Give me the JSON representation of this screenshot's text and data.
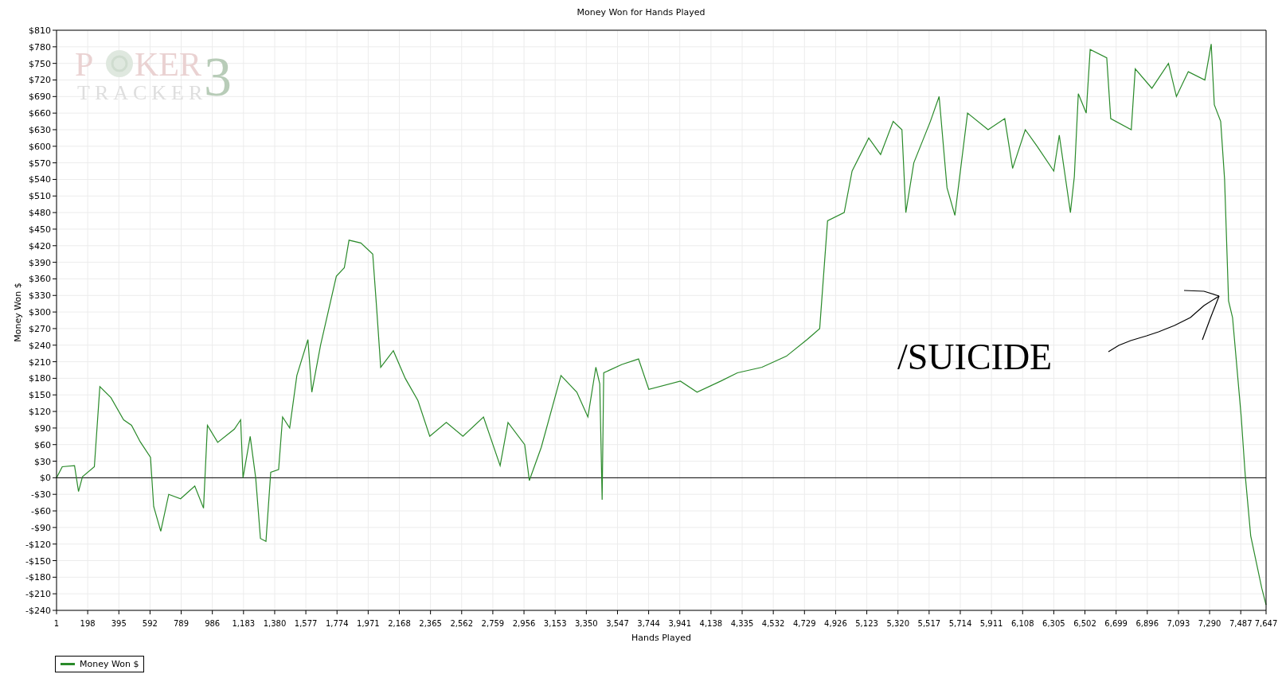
{
  "chart": {
    "watermark": {
      "first": "P",
      "rest": "KER",
      "numeral": "3",
      "second_line": "TRACKER"
    },
    "chart_data": {
      "type": "line",
      "title": "Money Won for Hands Played",
      "xlabel": "Hands Played",
      "ylabel": "Money Won $",
      "x": [
        1,
        37,
        115,
        140,
        165,
        240,
        275,
        345,
        425,
        475,
        530,
        595,
        615,
        660,
        710,
        785,
        875,
        930,
        955,
        1020,
        1125,
        1165,
        1180,
        1225,
        1260,
        1290,
        1325,
        1355,
        1405,
        1430,
        1475,
        1520,
        1590,
        1615,
        1670,
        1770,
        1820,
        1850,
        1925,
        2000,
        2025,
        2050,
        2130,
        2205,
        2285,
        2360,
        2465,
        2570,
        2700,
        2805,
        2855,
        2960,
        2990,
        3065,
        3190,
        3290,
        3360,
        3410,
        3435,
        3450,
        3460,
        3575,
        3680,
        3745,
        3945,
        4050,
        4200,
        4305,
        4460,
        4615,
        4745,
        4825,
        4875,
        4980,
        5030,
        5135,
        5210,
        5290,
        5345,
        5370,
        5420,
        5525,
        5580,
        5630,
        5680,
        5760,
        5890,
        5995,
        6045,
        6125,
        6200,
        6305,
        6340,
        6410,
        6435,
        6460,
        6510,
        6535,
        6640,
        6665,
        6795,
        6820,
        6925,
        7030,
        7080,
        7155,
        7260,
        7300,
        7320,
        7360,
        7385,
        7410,
        7435,
        7490,
        7515,
        7550,
        7620,
        7647
      ],
      "series": [
        {
          "name": "Money Won $",
          "color": "#2a8a2a",
          "values": [
            0,
            20,
            22,
            -25,
            2,
            20,
            165,
            145,
            105,
            95,
            65,
            37,
            -52,
            -97,
            -30,
            -38,
            -15,
            -55,
            95,
            64,
            88,
            105,
            0,
            75,
            0,
            -110,
            -115,
            10,
            15,
            110,
            90,
            185,
            250,
            155,
            240,
            365,
            380,
            430,
            425,
            405,
            305,
            200,
            230,
            180,
            140,
            75,
            100,
            75,
            110,
            22,
            100,
            60,
            -5,
            55,
            185,
            155,
            110,
            200,
            170,
            -40,
            190,
            205,
            215,
            160,
            175,
            155,
            175,
            190,
            200,
            220,
            250,
            270,
            465,
            480,
            555,
            615,
            585,
            645,
            630,
            480,
            570,
            645,
            690,
            525,
            475,
            660,
            630,
            650,
            560,
            630,
            600,
            555,
            620,
            480,
            545,
            695,
            660,
            775,
            760,
            650,
            630,
            740,
            705,
            750,
            690,
            735,
            720,
            785,
            675,
            645,
            540,
            320,
            290,
            110,
            5,
            -105,
            -200,
            -230
          ]
        }
      ],
      "grid": true,
      "xlim": [
        1,
        7647
      ],
      "ylim": [
        -240,
        810
      ],
      "xticks": [
        {
          "value": 1,
          "label": "1"
        },
        {
          "value": 198,
          "label": "198"
        },
        {
          "value": 395,
          "label": "395"
        },
        {
          "value": 592,
          "label": "592"
        },
        {
          "value": 789,
          "label": "789"
        },
        {
          "value": 986,
          "label": "986"
        },
        {
          "value": 1183,
          "label": "1,183"
        },
        {
          "value": 1380,
          "label": "1,380"
        },
        {
          "value": 1577,
          "label": "1,577"
        },
        {
          "value": 1774,
          "label": "1,774"
        },
        {
          "value": 1971,
          "label": "1,971"
        },
        {
          "value": 2168,
          "label": "2,168"
        },
        {
          "value": 2365,
          "label": "2,365"
        },
        {
          "value": 2562,
          "label": "2,562"
        },
        {
          "value": 2759,
          "label": "2,759"
        },
        {
          "value": 2956,
          "label": "2,956"
        },
        {
          "value": 3153,
          "label": "3,153"
        },
        {
          "value": 3350,
          "label": "3,350"
        },
        {
          "value": 3547,
          "label": "3,547"
        },
        {
          "value": 3744,
          "label": "3,744"
        },
        {
          "value": 3941,
          "label": "3,941"
        },
        {
          "value": 4138,
          "label": "4,138"
        },
        {
          "value": 4335,
          "label": "4,335"
        },
        {
          "value": 4532,
          "label": "4,532"
        },
        {
          "value": 4729,
          "label": "4,729"
        },
        {
          "value": 4926,
          "label": "4,926"
        },
        {
          "value": 5123,
          "label": "5,123"
        },
        {
          "value": 5320,
          "label": "5,320"
        },
        {
          "value": 5517,
          "label": "5,517"
        },
        {
          "value": 5714,
          "label": "5,714"
        },
        {
          "value": 5911,
          "label": "5,911"
        },
        {
          "value": 6108,
          "label": "6,108"
        },
        {
          "value": 6305,
          "label": "6,305"
        },
        {
          "value": 6502,
          "label": "6,502"
        },
        {
          "value": 6699,
          "label": "6,699"
        },
        {
          "value": 6896,
          "label": "6,896"
        },
        {
          "value": 7093,
          "label": "7,093"
        },
        {
          "value": 7290,
          "label": "7,290"
        },
        {
          "value": 7487,
          "label": "7,487"
        },
        {
          "value": 7647,
          "label": "7,647"
        }
      ],
      "yticks": [
        {
          "value": 810,
          "label": "$810"
        },
        {
          "value": 780,
          "label": "$780"
        },
        {
          "value": 750,
          "label": "$750"
        },
        {
          "value": 720,
          "label": "$720"
        },
        {
          "value": 690,
          "label": "$690"
        },
        {
          "value": 660,
          "label": "$660"
        },
        {
          "value": 630,
          "label": "$630"
        },
        {
          "value": 600,
          "label": "$600"
        },
        {
          "value": 570,
          "label": "$570"
        },
        {
          "value": 540,
          "label": "$540"
        },
        {
          "value": 510,
          "label": "$510"
        },
        {
          "value": 480,
          "label": "$480"
        },
        {
          "value": 450,
          "label": "$450"
        },
        {
          "value": 420,
          "label": "$420"
        },
        {
          "value": 390,
          "label": "$390"
        },
        {
          "value": 360,
          "label": "$360"
        },
        {
          "value": 330,
          "label": "$330"
        },
        {
          "value": 300,
          "label": "$300"
        },
        {
          "value": 270,
          "label": "$270"
        },
        {
          "value": 240,
          "label": "$240"
        },
        {
          "value": 210,
          "label": "$210"
        },
        {
          "value": 180,
          "label": "$180"
        },
        {
          "value": 150,
          "label": "$150"
        },
        {
          "value": 120,
          "label": "$120"
        },
        {
          "value": 90,
          "label": "$90"
        },
        {
          "value": 60,
          "label": "$60"
        },
        {
          "value": 30,
          "label": "$30"
        },
        {
          "value": 0,
          "label": "$0"
        },
        {
          "value": -30,
          "label": "-$30"
        },
        {
          "value": -60,
          "label": "-$60"
        },
        {
          "value": -90,
          "label": "-$90"
        },
        {
          "value": -120,
          "label": "-$120"
        },
        {
          "value": -150,
          "label": "-$150"
        },
        {
          "value": -180,
          "label": "-$180"
        },
        {
          "value": -210,
          "label": "-$210"
        },
        {
          "value": -240,
          "label": "-$240"
        }
      ],
      "annotations": [
        {
          "text": "/SUICIDE"
        }
      ]
    }
  }
}
